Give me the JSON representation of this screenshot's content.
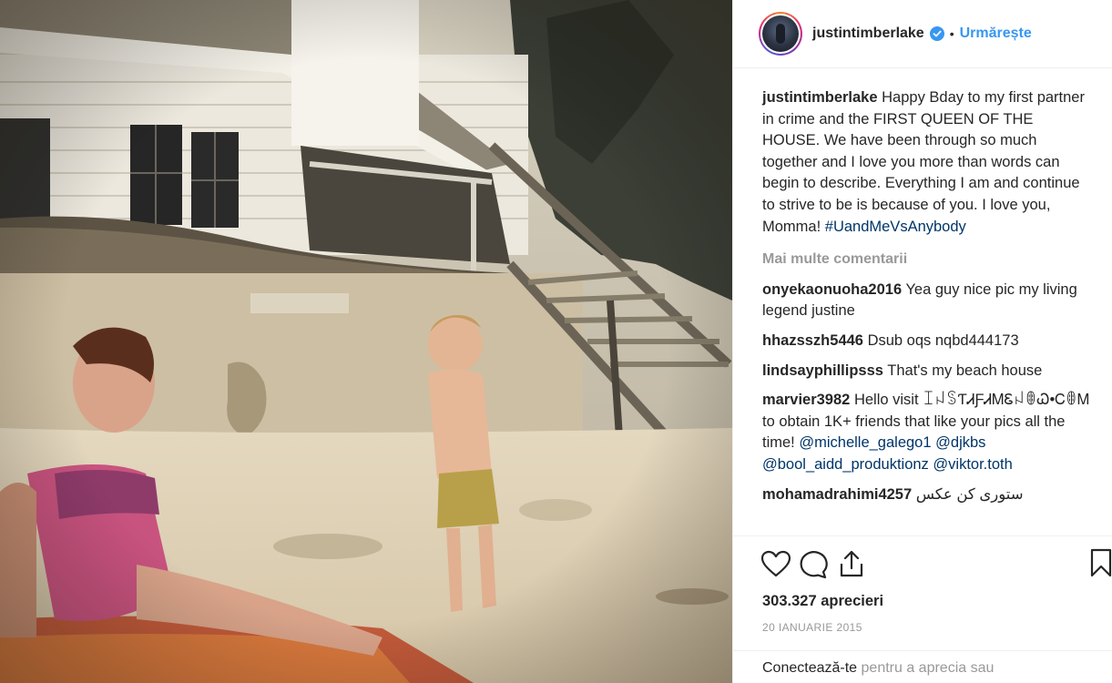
{
  "header": {
    "username": "justintimberlake",
    "separator": "•",
    "follow_label": "Urmărește"
  },
  "caption": {
    "username": "justintimberlake",
    "text": "Happy Bday to my first partner in crime and the FIRST QUEEN OF THE HOUSE. We have been through so much together and I love you more than words can begin to describe. Everything I am and continue to strive to be is because of you. I love you, Momma!",
    "hashtag": "#UandMeVsAnybody"
  },
  "more_comments_label": "Mai multe comentarii",
  "comments": [
    {
      "username": "onyekaonuoha2016",
      "text": "Yea guy nice pic my living legend justine"
    },
    {
      "username": "hhazsszh5446",
      "text": "Dsub oqs nqbd444173"
    },
    {
      "username": "lindsayphillipsss",
      "text": "That's my beach house"
    },
    {
      "username": "marvier3982",
      "text": "Hello visit ꀤꈤꌗƬᏗƑᏗᎷᏋꈤꂦᏇ•ᏟꂦᎷ to obtain 1K+ friends that like your pics all the time!",
      "mentions": [
        "@michelle_galego1",
        "@djkbs",
        "@bool_aidd_produktionz",
        "@viktor.toth"
      ]
    },
    {
      "username": "mohamadrahimi4257",
      "text": "ستوری کن عکس"
    }
  ],
  "likes": "303.327 aprecieri",
  "date": "20 IANUARIE 2015",
  "login": {
    "link": "Conectează-te",
    "text": "pentru a aprecia sau"
  },
  "icons": {
    "like": "heart-icon",
    "comment": "speech-bubble-icon",
    "share": "share-icon",
    "save": "bookmark-icon",
    "verified": "verified-badge-icon"
  },
  "colors": {
    "accent": "#3897f0",
    "text": "#262626",
    "muted": "#999999",
    "hashtag": "#003569"
  }
}
